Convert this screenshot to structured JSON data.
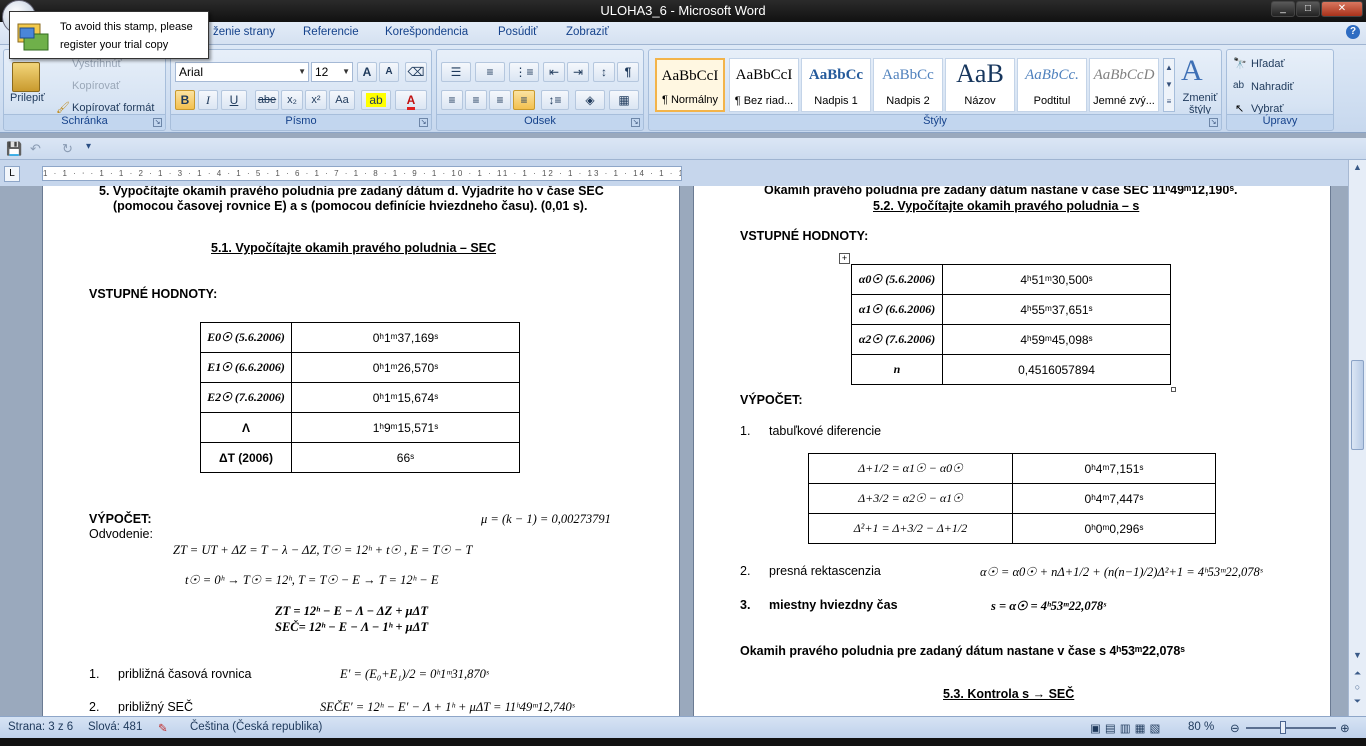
{
  "window": {
    "title": "ULOHA3_6 - Microsoft Word",
    "controls": [
      "_",
      "□",
      "✕"
    ]
  },
  "trial_stamp": {
    "line1": "To avoid this stamp, please",
    "line2": "register your trial copy"
  },
  "tabs": [
    "ženie strany",
    "Referencie",
    "Korešpondencia",
    "Posúdiť",
    "Zobraziť"
  ],
  "ribbon": {
    "clipboard": {
      "label": "Schránka",
      "paste": "Prilepiť",
      "cut": "Vystrihnúť",
      "copy": "Kopírovať",
      "format_painter": "Kopírovať formát"
    },
    "font": {
      "label": "Písmo",
      "font_name": "Arial",
      "font_size": "12",
      "bold": "B",
      "italic": "I",
      "underline": "U",
      "strike": "abe",
      "subscript": "x₂",
      "superscript": "x²",
      "case": "Aa",
      "grow": "A",
      "shrink": "A"
    },
    "paragraph": {
      "label": "Odsek",
      "pilcrow": "¶"
    },
    "styles": {
      "label": "Štýly",
      "items": [
        {
          "sample": "AaBbCcI",
          "name": "¶ Normálny"
        },
        {
          "sample": "AaBbCcI",
          "name": "¶ Bez riad..."
        },
        {
          "sample": "AaBbCc",
          "name": "Nadpis 1"
        },
        {
          "sample": "AaBbCc",
          "name": "Nadpis 2"
        },
        {
          "sample": "AaB",
          "name": "Názov"
        },
        {
          "sample": "AaBbCc.",
          "name": "Podtitul"
        },
        {
          "sample": "AaBbCcD",
          "name": "Jemné zvý..."
        }
      ],
      "change_styles": "Zmeniť štýly"
    },
    "editing": {
      "label": "Úpravy",
      "find": "Hľadať",
      "replace": "Nahradiť",
      "select": "Vybrať"
    }
  },
  "ruler_text": "1 · 1 · ⸱ · 1 · 1 · 2 · 1 · 3 · 1 · 4 · 1 · 5 · 1 · 6 · 1 · 7 · 1 · 8 · 1 · 9 · 1 · 10 · 1 · 11 · 1 · 12 · 1 · 13 · 1 · 14 · 1 · 15 · 1 · 16 · 1 · 17 · 1 · 19",
  "page_left": {
    "task_line1": "5. Vypočítajte okamih pravého poludnia pre zadaný dátum d. Vyjadrite ho v čase SEC",
    "task_line2": "(pomocou  časovej rovnice E) a s (pomocou definície hviezdneho času). (0,01 s).",
    "heading": "5.1. Vypočítajte okamih pravého poludnia – SEC",
    "inputs_label": "VSTUPNÉ HODNOTY:",
    "table": [
      {
        "key": "E0☉ (5.6.2006)",
        "value": "0ʰ1ᵐ37,169ˢ"
      },
      {
        "key": "E1☉ (6.6.2006)",
        "value": "0ʰ1ᵐ26,570ˢ"
      },
      {
        "key": "E2☉ (7.6.2006)",
        "value": "0ʰ1ᵐ15,674ˢ"
      },
      {
        "key": "Λ",
        "value": "1ʰ9ᵐ15,571ˢ"
      },
      {
        "key": "ΔT (2006)",
        "value": "66ˢ"
      }
    ],
    "calc_label": "VÝPOČET:",
    "mu": "μ = (k − 1) = 0,00273791",
    "derivation_label": "Odvodenie:",
    "eq1": "ZT = UT + ΔZ = T − λ − ΔZ,          T☉ = 12ʰ + t☉ ,       E = T☉ − T",
    "eq2": "t☉ = 0ʰ  →  T☉ = 12ʰ,              T = T☉ − E  → T = 12ʰ − E",
    "eq3": "ZT = 12ʰ − E − Λ − ΔZ + μΔT",
    "eq4": "SEČ= 12ʰ − E − Λ − 1ʰ + μΔT",
    "step1_num": "1.",
    "step1_label": "približná časová rovnica",
    "step1_eq": "E′ = (E₀+E₁)/2 = 0ʰ1ᵐ31,870ˢ",
    "step2_num": "2.",
    "step2_label": "približný SEČ",
    "step2_eq": "SEČE′ = 12ʰ − E′ − Λ + 1ʰ + μΔT = 11ʰ49ᵐ12,740ˢ"
  },
  "page_right": {
    "top_result": "Okamih pravého poludnia pre zadaný dátum nastane v čase SEČ 11ʰ49ᵐ12,190ˢ.",
    "heading": "5.2. Vypočítajte okamih pravého poludnia – s",
    "inputs_label": "VSTUPNÉ HODNOTY:",
    "table": [
      {
        "key": "α0☉ (5.6.2006)",
        "value": "4ʰ51ᵐ30,500ˢ"
      },
      {
        "key": "α1☉ (6.6.2006)",
        "value": "4ʰ55ᵐ37,651ˢ"
      },
      {
        "key": "α2☉ (7.6.2006)",
        "value": "4ʰ59ᵐ45,098ˢ"
      },
      {
        "key": "n",
        "value": "0,4516057894"
      }
    ],
    "calc_label": "VÝPOČET:",
    "step1_num": "1.",
    "step1_label": "tabuľkové diferencie",
    "diff_table": [
      {
        "key": "Δ+1/2 = α1☉ − α0☉",
        "value": "0ʰ4ᵐ7,151ˢ"
      },
      {
        "key": "Δ+3/2 = α2☉ − α1☉",
        "value": "0ʰ4ᵐ7,447ˢ"
      },
      {
        "key": "Δ²+1 = Δ+3/2 − Δ+1/2",
        "value": "0ʰ0ᵐ0,296ˢ"
      }
    ],
    "step2_num": "2.",
    "step2_label": "presná rektascenzia",
    "step2_eq": "α☉ = α0☉ + nΔ+1/2 + (n(n−1)/2)Δ²+1 = 4ʰ53ᵐ22,078ˢ",
    "step3_num": "3.",
    "step3_label": "miestny hviezdny čas",
    "step3_eq": "s = α☉ = 4ʰ53ᵐ22,078ˢ",
    "result": "Okamih pravého poludnia pre zadaný dátum nastane v čase s 4ʰ53ᵐ22,078ˢ",
    "heading3": "5.3. Kontrola s → SEČ"
  },
  "status": {
    "page": "Strana: 3 z 6",
    "words": "Slová: 481",
    "language": "Čeština (Česká republika)",
    "zoom": "80 %"
  }
}
